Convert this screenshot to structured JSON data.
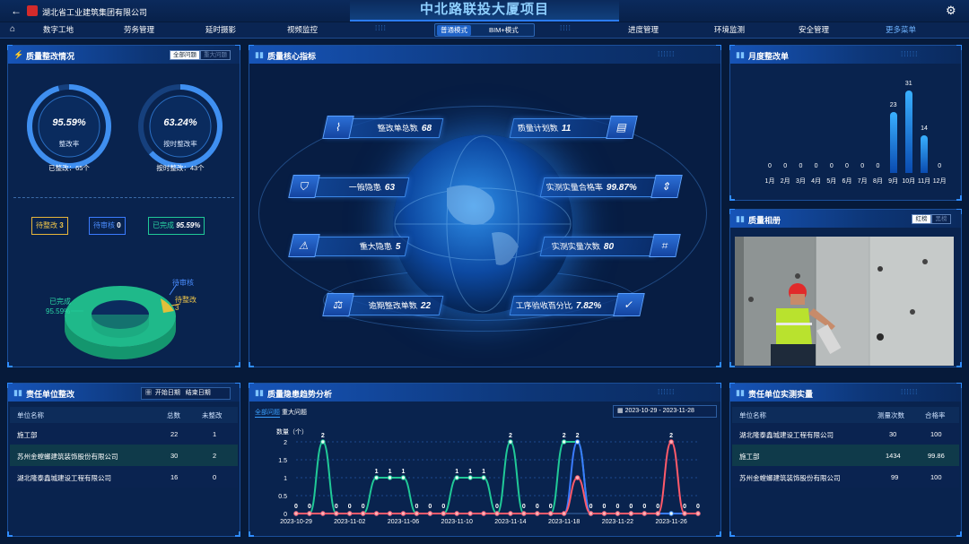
{
  "header": {
    "company": "湖北省工业建筑集团有限公司",
    "project_title": "中北路联投大厦项目"
  },
  "nav": {
    "items": [
      "数字工地",
      "劳务管理",
      "延时摄影",
      "视频监控",
      "进度管理",
      "环境监测",
      "安全管理",
      "更多菜单"
    ],
    "modes": [
      "普通模式",
      "BIM+模式"
    ]
  },
  "rectify": {
    "title": "质量整改情况",
    "toggles": [
      "全部问题",
      "重大问题"
    ],
    "gauge1": {
      "value": "95.59%",
      "label": "整改率",
      "sub": "已整改：65个",
      "fraction": 0.9559
    },
    "gauge2": {
      "value": "63.24%",
      "label": "按时整改率",
      "sub": "按时整改：43个",
      "fraction": 0.6324
    },
    "legend": {
      "pending": "待整改",
      "pending_val": "3",
      "review": "待审核",
      "review_val": "0",
      "done": "已完成",
      "done_val": "95.59%"
    },
    "ring_labels": {
      "review": "待审核",
      "pending": "待整改",
      "pending_val": "3",
      "done": "已完成",
      "done_val": "95.59%"
    }
  },
  "core": {
    "title": "质量核心指标",
    "metrics": [
      {
        "label": "整改单总数",
        "value": "68"
      },
      {
        "label": "质量计划数",
        "value": "11"
      },
      {
        "label": "一般隐患",
        "value": "63"
      },
      {
        "label": "实测实量合格率",
        "value": "99.87%"
      },
      {
        "label": "重大隐患",
        "value": "5"
      },
      {
        "label": "实测实量次数",
        "value": "80"
      },
      {
        "label": "逾期整改单数",
        "value": "22"
      },
      {
        "label": "工序验收百分比",
        "value": "7.82%"
      }
    ]
  },
  "monthly": {
    "title": "月度整改单",
    "months": [
      "1月",
      "2月",
      "3月",
      "4月",
      "5月",
      "6月",
      "7月",
      "8月",
      "9月",
      "10月",
      "11月",
      "12月"
    ],
    "values": [
      0,
      0,
      0,
      0,
      0,
      0,
      0,
      0,
      23,
      31,
      14,
      0
    ]
  },
  "album": {
    "title": "质量相册",
    "toggles": [
      "红榜",
      "黑榜"
    ]
  },
  "unit_rectify": {
    "title": "责任单位整改",
    "start": "开始日期",
    "end": "结束日期",
    "headers": [
      "单位名称",
      "总数",
      "未整改"
    ],
    "rows": [
      [
        "施工部",
        "22",
        "1"
      ],
      [
        "苏州金螳螂建筑装饰股份有限公司",
        "30",
        "2"
      ],
      [
        "湖北隆泰鑫城建设工程有限公司",
        "16",
        "0"
      ]
    ]
  },
  "trend": {
    "title": "质量隐患趋势分析",
    "tabs": [
      "全部问题",
      "重大问题"
    ],
    "date_start": "2023-10-29",
    "date_end": "2023-11-28",
    "date_sep": "-",
    "ylabel": "数量（个）"
  },
  "measure": {
    "title": "责任单位实测实量",
    "headers": [
      "单位名称",
      "测量次数",
      "合格率"
    ],
    "rows": [
      [
        "湖北隆泰鑫城建设工程有限公司",
        "30",
        "100"
      ],
      [
        "施工部",
        "1434",
        "99.86"
      ],
      [
        "苏州金螳螂建筑装饰股份有限公司",
        "99",
        "100"
      ]
    ]
  },
  "chart_data": {
    "type": "line",
    "ylabel": "数量（个）",
    "ylim": [
      0,
      2
    ],
    "yticks": [
      "0",
      "0.5",
      "1",
      "1.5",
      "2"
    ],
    "xtick_labels": [
      "2023-10-29",
      "2023-11-02",
      "2023-11-06",
      "2023-11-10",
      "2023-11-14",
      "2023-11-18",
      "2023-11-22",
      "2023-11-26"
    ],
    "x": [
      "2023-10-29",
      "2023-10-30",
      "2023-10-31",
      "2023-11-01",
      "2023-11-02",
      "2023-11-03",
      "2023-11-04",
      "2023-11-05",
      "2023-11-06",
      "2023-11-07",
      "2023-11-08",
      "2023-11-09",
      "2023-11-10",
      "2023-11-11",
      "2023-11-12",
      "2023-11-13",
      "2023-11-14",
      "2023-11-15",
      "2023-11-16",
      "2023-11-17",
      "2023-11-18",
      "2023-11-19",
      "2023-11-20",
      "2023-11-21",
      "2023-11-22",
      "2023-11-23",
      "2023-11-24",
      "2023-11-25",
      "2023-11-26",
      "2023-11-27",
      "2023-11-28"
    ],
    "series": [
      {
        "values": [
          0,
          0,
          2,
          0,
          0,
          0,
          1,
          1,
          1,
          0,
          0,
          0,
          1,
          1,
          1,
          0,
          2,
          0,
          0,
          0,
          2,
          2,
          0,
          0,
          0,
          0,
          0,
          0,
          0,
          0,
          0
        ],
        "color": "#20c997"
      },
      {
        "values": [
          0,
          0,
          0,
          0,
          0,
          0,
          0,
          0,
          0,
          0,
          0,
          0,
          0,
          0,
          0,
          0,
          0,
          0,
          0,
          0,
          0,
          2,
          0,
          0,
          0,
          0,
          0,
          0,
          0,
          0,
          0
        ],
        "color": "#3a7bff"
      },
      {
        "values": [
          0,
          0,
          0,
          0,
          0,
          0,
          0,
          0,
          0,
          0,
          0,
          0,
          0,
          0,
          0,
          0,
          0,
          0,
          0,
          0,
          0,
          1,
          0,
          0,
          0,
          0,
          0,
          0,
          2,
          0,
          0
        ],
        "color": "#ff5a6a"
      }
    ],
    "labeled_points": [
      {
        "x": "2023-10-31",
        "label": "2"
      },
      {
        "x": "2023-11-04",
        "label": "1"
      },
      {
        "x": "2023-11-05",
        "label": "1"
      },
      {
        "x": "2023-11-06",
        "label": "1"
      },
      {
        "x": "2023-11-10",
        "label": "1"
      },
      {
        "x": "2023-11-11",
        "label": "1"
      },
      {
        "x": "2023-11-12",
        "label": "1"
      },
      {
        "x": "2023-11-14",
        "label": "2"
      },
      {
        "x": "2023-11-18",
        "label": "2"
      },
      {
        "x": "2023-11-19",
        "label": "2"
      },
      {
        "x": "2023-11-26",
        "label": "2"
      }
    ]
  }
}
